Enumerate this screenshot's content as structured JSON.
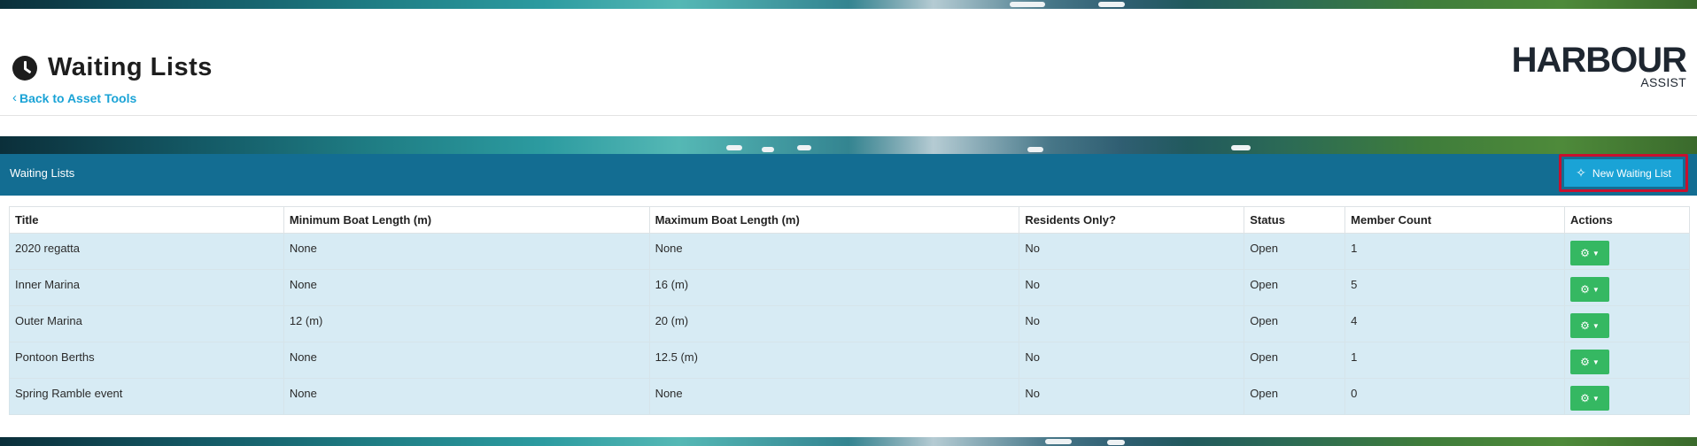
{
  "page": {
    "title": "Waiting Lists",
    "back_link": "Back to Asset Tools"
  },
  "logo": {
    "main": "HARBOUR",
    "sub": "ASSIST"
  },
  "panel": {
    "title": "Waiting Lists",
    "new_button": "New Waiting List"
  },
  "table": {
    "headers": [
      "Title",
      "Minimum Boat Length (m)",
      "Maximum Boat Length (m)",
      "Residents Only?",
      "Status",
      "Member Count",
      "Actions"
    ],
    "rows": [
      {
        "title": "2020 regatta",
        "min": "None",
        "max": "None",
        "residents": "No",
        "status": "Open",
        "count": "1"
      },
      {
        "title": "Inner Marina",
        "min": "None",
        "max": "16 (m)",
        "residents": "No",
        "status": "Open",
        "count": "5"
      },
      {
        "title": "Outer Marina",
        "min": "12 (m)",
        "max": "20 (m)",
        "residents": "No",
        "status": "Open",
        "count": "4"
      },
      {
        "title": "Pontoon Berths",
        "min": "None",
        "max": "12.5 (m)",
        "residents": "No",
        "status": "Open",
        "count": "1"
      },
      {
        "title": "Spring Ramble event",
        "min": "None",
        "max": "None",
        "residents": "No",
        "status": "Open",
        "count": "0"
      }
    ]
  },
  "icons": {
    "title": "clock-icon",
    "back": "chevron-left-icon",
    "new": "magic-wand-icon",
    "action": "gear-icon",
    "dropdown": "caret-down-icon"
  },
  "colors": {
    "panel_header": "#136d92",
    "link": "#1aa3d6",
    "new_button": "#1aa3d6",
    "highlight_border": "#c8102e",
    "action_button": "#35b862",
    "row_background": "#d7ebf4"
  }
}
